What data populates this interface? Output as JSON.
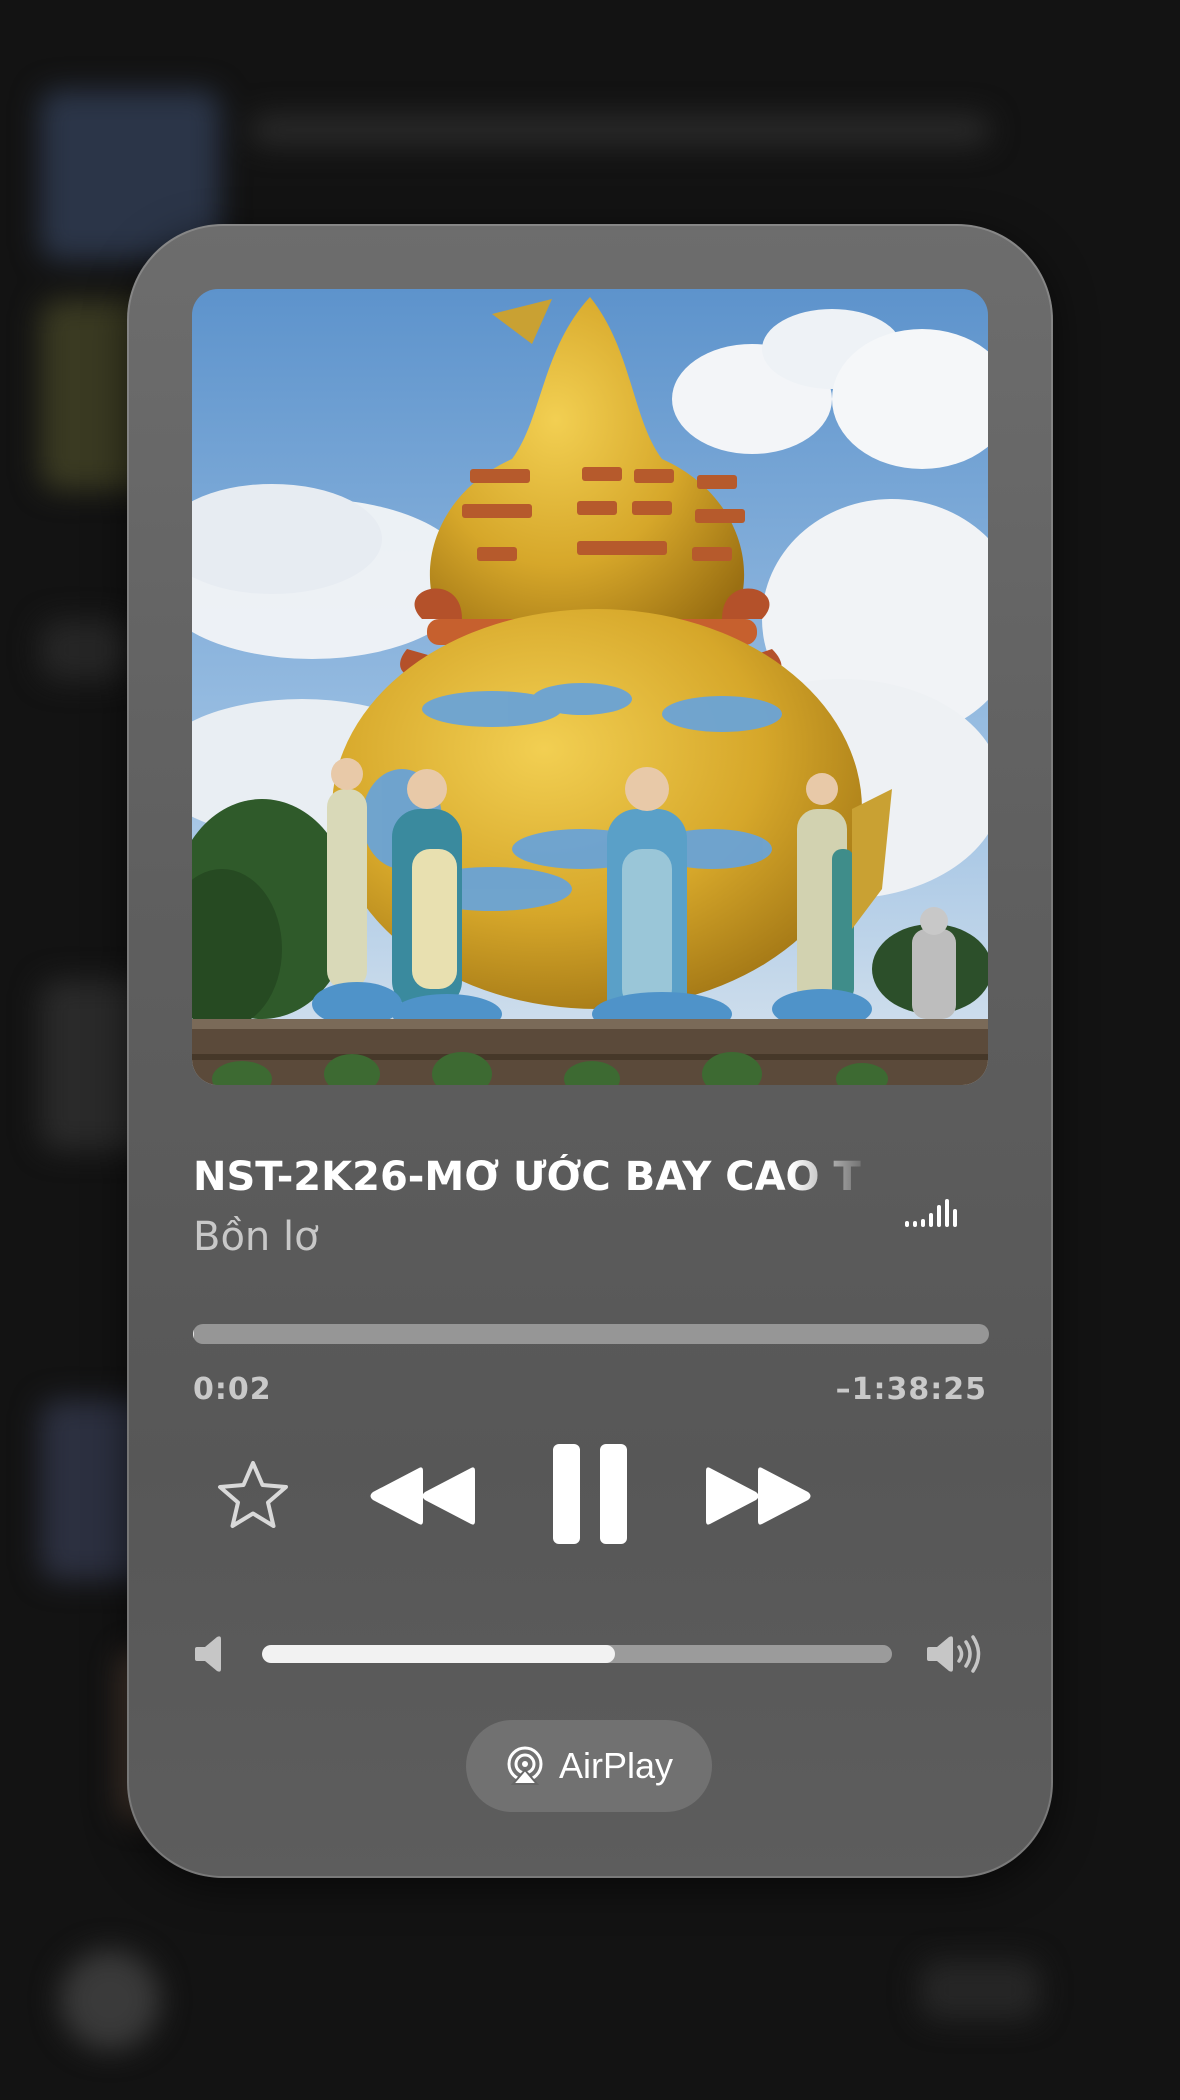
{
  "track": {
    "title": "NST-2K26-MƠ ƯỚC BAY CAO T",
    "artist": "Bồn lơ"
  },
  "playback": {
    "state": "playing",
    "elapsed": "0:02",
    "remaining": "–1:38:25",
    "progress_fraction": 0.0003
  },
  "volume": {
    "level_fraction": 0.56
  },
  "controls": {
    "favorite_icon": "star-outline-icon",
    "rewind_icon": "rewind-icon",
    "pause_icon": "pause-icon",
    "forward_icon": "fast-forward-icon",
    "volume_low_icon": "speaker-low-icon",
    "volume_high_icon": "speaker-high-icon",
    "level_meter_icon": "audio-level-meter-icon"
  },
  "output": {
    "airplay_label": "AirPlay",
    "airplay_icon": "airplay-icon"
  },
  "colors": {
    "card": "#606060",
    "text_primary": "#ffffff",
    "text_secondary": "#c8c8c8",
    "background": "#131313"
  }
}
